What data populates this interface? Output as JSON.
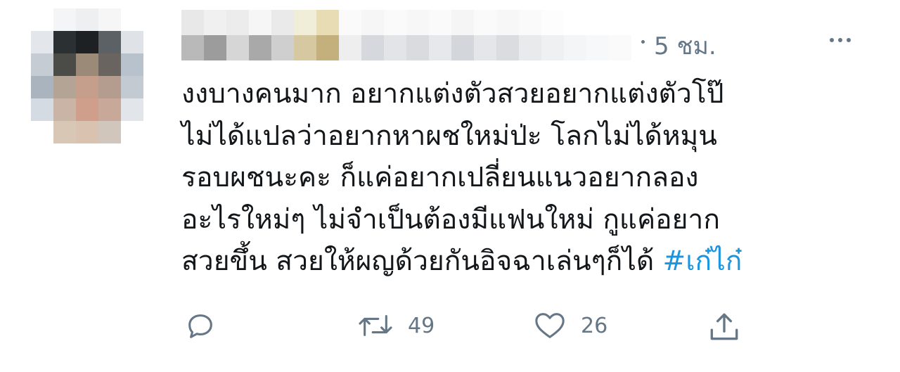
{
  "tweet": {
    "timestamp": "5 ชม.",
    "text_lines": [
      "งงบางคนมาก อยากแต่งตัวสวยอยากแต่งตัวโป๊",
      "ไม่ได้แปลว่าอยากหาผชใหม่ป่ะ โลกไม่ได้หมุน",
      "รอบผชนะคะ ก็แค่อยากเปลี่ยนแนวอยากลอง",
      "อะไรใหม่ๆ ไม่จำเป็นต้องมีแฟนใหม่ กูแค่อยาก",
      "สวยขึ้น สวยให้ผญด้วยกันอิจฉาเล่นๆก็ได้ "
    ],
    "hashtag": "#เก๋ไก๋",
    "actions": {
      "reply_icon": "reply-icon",
      "retweet_icon": "retweet-icon",
      "retweet_count": "49",
      "like_icon": "heart-icon",
      "like_count": "26",
      "share_icon": "share-icon"
    }
  },
  "colors": {
    "text": "#14171a",
    "secondary": "#657786",
    "link": "#1b95e0"
  }
}
